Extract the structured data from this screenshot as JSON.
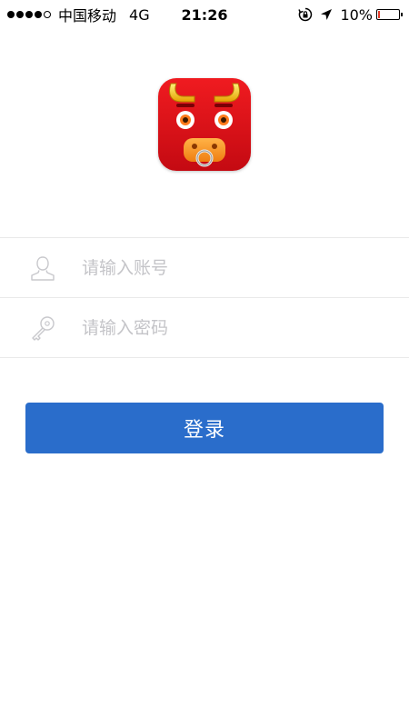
{
  "status_bar": {
    "signal_strength": "4 of 5",
    "carrier": "中国移动",
    "network": "4G",
    "time": "21:26",
    "orientation_lock_icon": "orientation-lock-icon",
    "location_icon": "location-arrow-icon",
    "battery_percent_text": "10%",
    "battery_level": 0.1,
    "battery_color": "#e53b2a"
  },
  "app": {
    "logo_icon": "bull-face-app-icon",
    "logo_color": "#e0121a"
  },
  "login_form": {
    "account": {
      "icon": "user-icon",
      "value": "",
      "placeholder": "请输入账号"
    },
    "password": {
      "icon": "key-icon",
      "value": "",
      "placeholder": "请输入密码"
    },
    "submit_label": "登录",
    "submit_color": "#2a6dcb"
  }
}
